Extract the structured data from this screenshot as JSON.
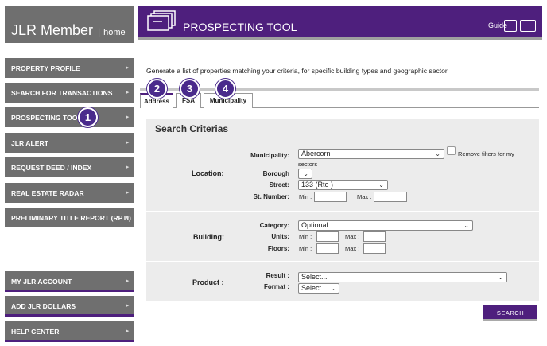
{
  "brand": {
    "name": "JLR Member",
    "separator": "|",
    "home_link": "home"
  },
  "sidebar": {
    "items": [
      {
        "label": "PROPERTY PROFILE"
      },
      {
        "label": "SEARCH FOR TRANSACTIONS"
      },
      {
        "label": "PROSPECTING TOOL"
      },
      {
        "label": "JLR ALERT"
      },
      {
        "label": "REQUEST DEED / INDEX"
      },
      {
        "label": "REAL ESTATE RADAR"
      },
      {
        "label": "PRELIMINARY TITLE REPORT (RPTI)"
      }
    ],
    "bottom_items": [
      {
        "label": "MY JLR ACCOUNT"
      },
      {
        "label": "ADD JLR DOLLARS"
      },
      {
        "label": "HELP CENTER"
      }
    ],
    "arrow": "▸"
  },
  "header": {
    "title": "PROSPECTING TOOL",
    "guide_label": "Guide",
    "icons": [
      "pdf-guide-icon",
      "video-guide-icon"
    ]
  },
  "intro_text": "Generate a list of properties matching your criteria, for specific building types and geographic sector.",
  "tabs": [
    {
      "label": "Address",
      "badge": "2"
    },
    {
      "label": "FSA",
      "badge": "3"
    },
    {
      "label": "Municipality",
      "badge": "4"
    }
  ],
  "annotation_badge": "1",
  "search": {
    "title": "Search Criterias",
    "location": {
      "label": "Location:",
      "municipality_label": "Municipality:",
      "municipality_value": "Abercorn",
      "remove_filters_label": "Remove filters for my",
      "remove_filters_label_cont": "sectors",
      "borough_label": "Borough",
      "street_label": "Street:",
      "street_value": "133 (Rte )",
      "st_number_label": "St. Number:",
      "min_label": "Min :",
      "max_label": "Max :"
    },
    "building": {
      "label": "Building:",
      "category_label": "Category:",
      "category_value": "Optional",
      "units_label": "Units:",
      "floors_label": "Floors:",
      "min_label": "Min :",
      "max_label": "Max :"
    },
    "product": {
      "label": "Product :",
      "result_label": "Result :",
      "result_value": "Select...",
      "format_label": "Format :",
      "format_value": "Select..."
    },
    "submit_label": "SEARCH"
  },
  "colors": {
    "brand_purple": "#4e1f7d",
    "sidebar_gray": "#6f6f6f",
    "badge": "#4a2a8c"
  }
}
